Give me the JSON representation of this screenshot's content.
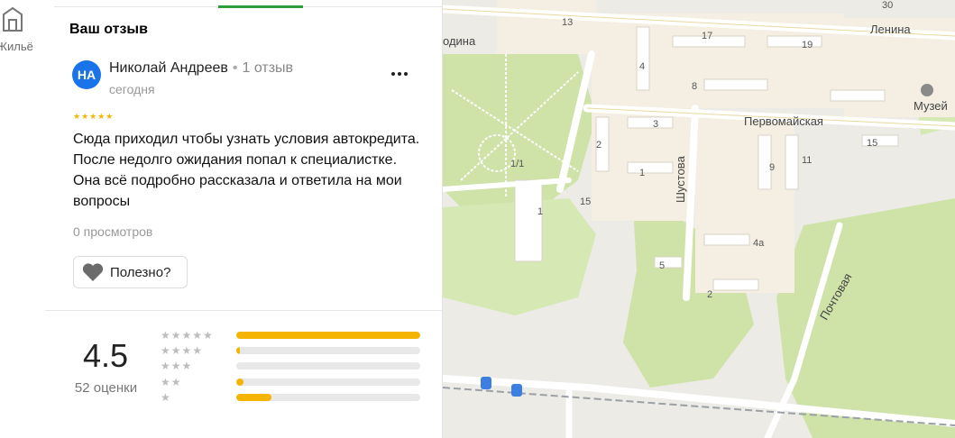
{
  "rail": {
    "label": "Жильё",
    "icon": "building-icon"
  },
  "review_section": {
    "title": "Ваш отзыв",
    "avatar_initials": "НА",
    "author": "Николай Андреев",
    "author_reviews": "1 отзыв",
    "date": "сегодня",
    "rating": 5,
    "stars": "★★★★★",
    "text": "Сюда приходил чтобы узнать условия автокредита. После недолго ожидания попал к специалистке. Она всё подробно рассказала и ответила на мои вопросы",
    "views": "0 просмотров",
    "useful_label": "Полезно?"
  },
  "rating_summary": {
    "score": "4.5",
    "count_label": "52 оценки",
    "distribution": [
      {
        "stars": "★★★★★",
        "fraction": 1.0
      },
      {
        "stars": "★★★★",
        "fraction": 0.02
      },
      {
        "stars": "★★★",
        "fraction": 0.0
      },
      {
        "stars": "★★",
        "fraction": 0.04
      },
      {
        "stars": "★",
        "fraction": 0.19
      }
    ]
  },
  "map": {
    "streets": [
      "Ленина",
      "Первомайская",
      "Шустова",
      "Почтовая"
    ],
    "poi": "Музей",
    "partial_label": "одина",
    "building_numbers": [
      "13",
      "30",
      "17",
      "19",
      "4",
      "8",
      "3",
      "2",
      "1/1",
      "15",
      "1",
      "9",
      "11",
      "15",
      "1",
      "5",
      "4а",
      "2"
    ],
    "colors": {
      "park": "#cfe3a8",
      "block": "#f4efe2",
      "road": "#ffffff",
      "rail": "#9aa0a6"
    }
  },
  "colors": {
    "accent_green": "#2f9e3a",
    "star_yellow": "#f5b400",
    "avatar_blue": "#1a73e8"
  }
}
